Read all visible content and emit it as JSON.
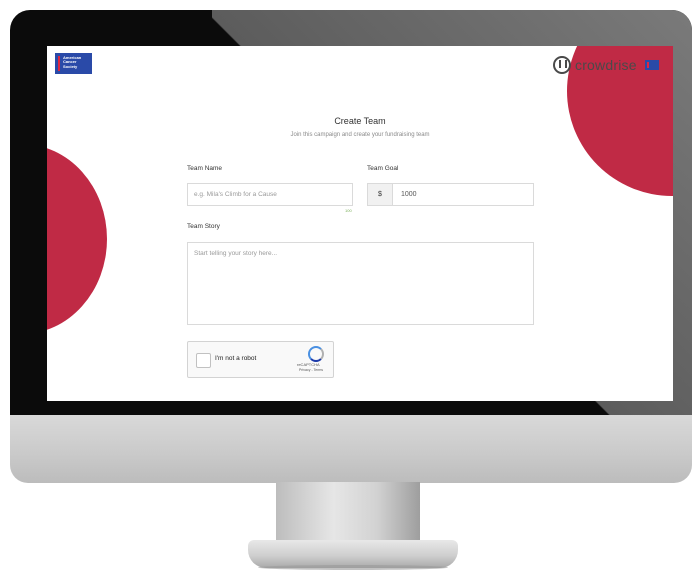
{
  "header": {
    "acs_logo_text": [
      "American",
      "Cancer",
      "Society"
    ],
    "brand_name": "crowdrise"
  },
  "form": {
    "title": "Create Team",
    "subtitle": "Join this campaign and create your fundraising team",
    "team_name_label": "Team Name",
    "team_name_placeholder": "e.g. Mila's Climb for a Cause",
    "team_name_counter": "100",
    "team_goal_label": "Team Goal",
    "currency_symbol": "$",
    "team_goal_value": "1000",
    "team_story_label": "Team Story",
    "team_story_placeholder": "Start telling your story here..."
  },
  "captcha": {
    "label": "I'm not a robot",
    "brand": "reCAPTCHA",
    "links": "Privacy - Terms"
  },
  "colors": {
    "accent_red": "#c02a45",
    "acs_blue": "#2a4aa8"
  }
}
